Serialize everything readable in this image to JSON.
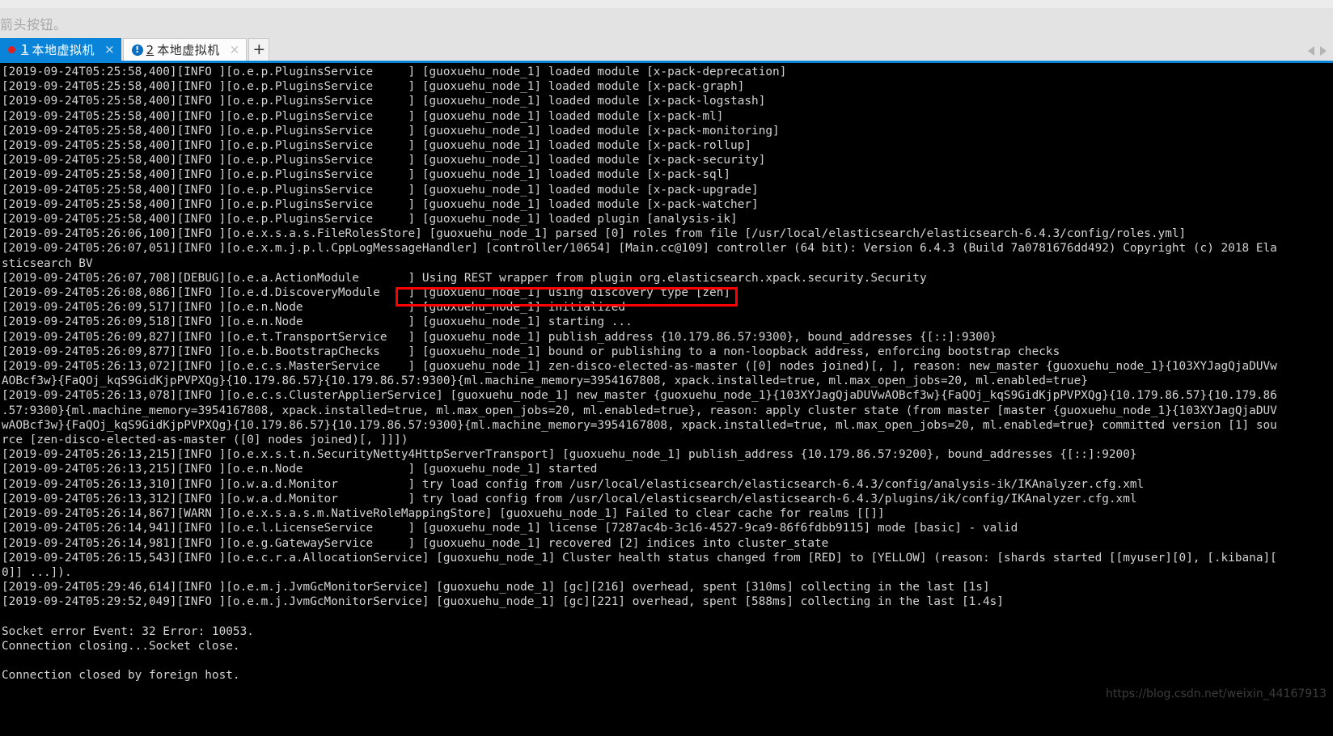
{
  "chrome": {
    "hint_text": "箭头按钮。"
  },
  "tabbar": {
    "tabs": [
      {
        "index": "1",
        "label": "本地虚拟机",
        "status_icon": "red-dot-icon",
        "close_label": "×",
        "active": true
      },
      {
        "index": "2",
        "label": "本地虚拟机",
        "status_icon": "info-badge-icon",
        "status_glyph": "!",
        "close_label": "×",
        "active": false
      }
    ],
    "add_tab_label": "+",
    "scroll_left_icon": "chevron-left-icon",
    "scroll_right_icon": "chevron-right-icon",
    "accent_color": "#0a84d8"
  },
  "terminal": {
    "foreground": "#d4d4d4",
    "background": "#000000",
    "highlight_color": "#ff0000",
    "highlighted_line_index": 11,
    "lines": [
      "[2019-09-24T05:25:58,400][INFO ][o.e.p.PluginsService     ] [guoxuehu_node_1] loaded module [x-pack-deprecation]",
      "[2019-09-24T05:25:58,400][INFO ][o.e.p.PluginsService     ] [guoxuehu_node_1] loaded module [x-pack-graph]",
      "[2019-09-24T05:25:58,400][INFO ][o.e.p.PluginsService     ] [guoxuehu_node_1] loaded module [x-pack-logstash]",
      "[2019-09-24T05:25:58,400][INFO ][o.e.p.PluginsService     ] [guoxuehu_node_1] loaded module [x-pack-ml]",
      "[2019-09-24T05:25:58,400][INFO ][o.e.p.PluginsService     ] [guoxuehu_node_1] loaded module [x-pack-monitoring]",
      "[2019-09-24T05:25:58,400][INFO ][o.e.p.PluginsService     ] [guoxuehu_node_1] loaded module [x-pack-rollup]",
      "[2019-09-24T05:25:58,400][INFO ][o.e.p.PluginsService     ] [guoxuehu_node_1] loaded module [x-pack-security]",
      "[2019-09-24T05:25:58,400][INFO ][o.e.p.PluginsService     ] [guoxuehu_node_1] loaded module [x-pack-sql]",
      "[2019-09-24T05:25:58,400][INFO ][o.e.p.PluginsService     ] [guoxuehu_node_1] loaded module [x-pack-upgrade]",
      "[2019-09-24T05:25:58,400][INFO ][o.e.p.PluginsService     ] [guoxuehu_node_1] loaded module [x-pack-watcher]",
      "[2019-09-24T05:25:58,400][INFO ][o.e.p.PluginsService     ] [guoxuehu_node_1] loaded plugin [analysis-ik]",
      "[2019-09-24T05:26:06,100][INFO ][o.e.x.s.a.s.FileRolesStore] [guoxuehu_node_1] parsed [0] roles from file [/usr/local/elasticsearch/elasticsearch-6.4.3/config/roles.yml]",
      "[2019-09-24T05:26:07,051][INFO ][o.e.x.m.j.p.l.CppLogMessageHandler] [controller/10654] [Main.cc@109] controller (64 bit): Version 6.4.3 (Build 7a0781676dd492) Copyright (c) 2018 Ela",
      "sticsearch BV",
      "[2019-09-24T05:26:07,708][DEBUG][o.e.a.ActionModule       ] Using REST wrapper from plugin org.elasticsearch.xpack.security.Security",
      "[2019-09-24T05:26:08,086][INFO ][o.e.d.DiscoveryModule    ] [guoxuehu_node_1] using discovery type [zen]",
      "[2019-09-24T05:26:09,517][INFO ][o.e.n.Node               ] [guoxuehu_node_1] initialized",
      "[2019-09-24T05:26:09,518][INFO ][o.e.n.Node               ] [guoxuehu_node_1] starting ...",
      "[2019-09-24T05:26:09,827][INFO ][o.e.t.TransportService   ] [guoxuehu_node_1] publish_address {10.179.86.57:9300}, bound_addresses {[::]:9300}",
      "[2019-09-24T05:26:09,877][INFO ][o.e.b.BootstrapChecks    ] [guoxuehu_node_1] bound or publishing to a non-loopback address, enforcing bootstrap checks",
      "[2019-09-24T05:26:13,072][INFO ][o.e.c.s.MasterService    ] [guoxuehu_node_1] zen-disco-elected-as-master ([0] nodes joined)[, ], reason: new_master {guoxuehu_node_1}{103XYJagQjaDUVw",
      "AOBcf3w}{FaQOj_kqS9GidKjpPVPXQg}{10.179.86.57}{10.179.86.57:9300}{ml.machine_memory=3954167808, xpack.installed=true, ml.max_open_jobs=20, ml.enabled=true}",
      "[2019-09-24T05:26:13,078][INFO ][o.e.c.s.ClusterApplierService] [guoxuehu_node_1] new_master {guoxuehu_node_1}{103XYJagQjaDUVwAOBcf3w}{FaQOj_kqS9GidKjpPVPXQg}{10.179.86.57}{10.179.86",
      ".57:9300}{ml.machine_memory=3954167808, xpack.installed=true, ml.max_open_jobs=20, ml.enabled=true}, reason: apply cluster state (from master [master {guoxuehu_node_1}{103XYJagQjaDUV",
      "wAOBcf3w}{FaQOj_kqS9GidKjpPVPXQg}{10.179.86.57}{10.179.86.57:9300}{ml.machine_memory=3954167808, xpack.installed=true, ml.max_open_jobs=20, ml.enabled=true} committed version [1] sou",
      "rce [zen-disco-elected-as-master ([0] nodes joined)[, ]]])",
      "[2019-09-24T05:26:13,215][INFO ][o.e.x.s.t.n.SecurityNetty4HttpServerTransport] [guoxuehu_node_1] publish_address {10.179.86.57:9200}, bound_addresses {[::]:9200}",
      "[2019-09-24T05:26:13,215][INFO ][o.e.n.Node               ] [guoxuehu_node_1] started",
      "[2019-09-24T05:26:13,310][INFO ][o.w.a.d.Monitor          ] try load config from /usr/local/elasticsearch/elasticsearch-6.4.3/config/analysis-ik/IKAnalyzer.cfg.xml",
      "[2019-09-24T05:26:13,312][INFO ][o.w.a.d.Monitor          ] try load config from /usr/local/elasticsearch/elasticsearch-6.4.3/plugins/ik/config/IKAnalyzer.cfg.xml",
      "[2019-09-24T05:26:14,867][WARN ][o.e.x.s.a.s.m.NativeRoleMappingStore] [guoxuehu_node_1] Failed to clear cache for realms [[]]",
      "[2019-09-24T05:26:14,941][INFO ][o.e.l.LicenseService     ] [guoxuehu_node_1] license [7287ac4b-3c16-4527-9ca9-86f6fdbb9115] mode [basic] - valid",
      "[2019-09-24T05:26:14,981][INFO ][o.e.g.GatewayService     ] [guoxuehu_node_1] recovered [2] indices into cluster_state",
      "[2019-09-24T05:26:15,543][INFO ][o.e.c.r.a.AllocationService] [guoxuehu_node_1] Cluster health status changed from [RED] to [YELLOW] (reason: [shards started [[myuser][0], [.kibana][",
      "0]] ...]).",
      "[2019-09-24T05:29:46,614][INFO ][o.e.m.j.JvmGcMonitorService] [guoxuehu_node_1] [gc][216] overhead, spent [310ms] collecting in the last [1s]",
      "[2019-09-24T05:29:52,049][INFO ][o.e.m.j.JvmGcMonitorService] [guoxuehu_node_1] [gc][221] overhead, spent [588ms] collecting in the last [1.4s]",
      "",
      "Socket error Event: 32 Error: 10053.",
      "Connection closing...Socket close.",
      "",
      "Connection closed by foreign host."
    ]
  },
  "watermark": {
    "text": "https://blog.csdn.net/weixin_44167913"
  }
}
